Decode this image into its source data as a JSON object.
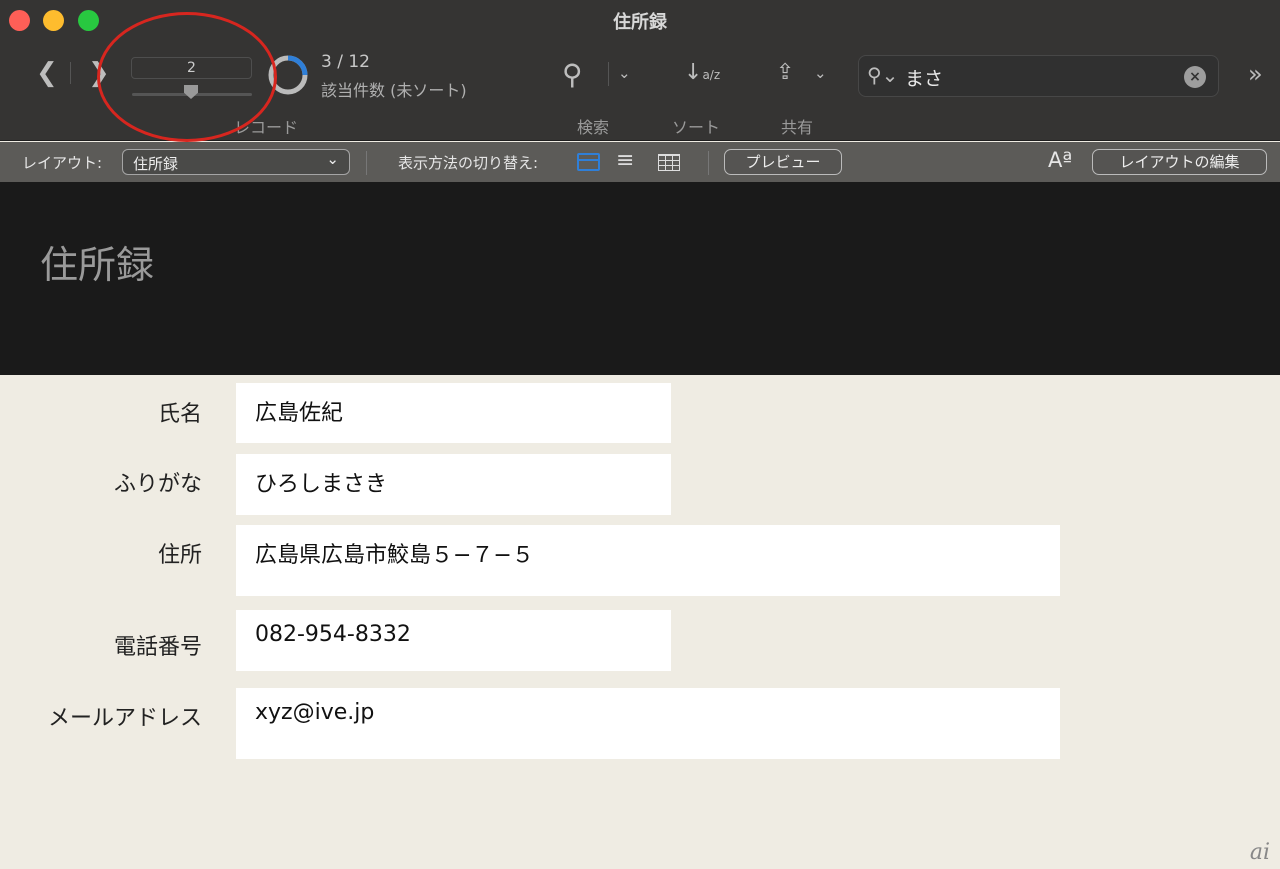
{
  "window": {
    "title": "住所録"
  },
  "toolbar": {
    "record_value": "2",
    "found_count": "3 / 12",
    "found_status": "該当件数 (未ソート)",
    "record_label": "レコード",
    "search_label": "検索",
    "sort_label": "ソート",
    "share_label": "共有",
    "search_query": "まさ",
    "found_fraction": 0.25
  },
  "layoutbar": {
    "layout_label": "レイアウト:",
    "layout_value": "住所録",
    "view_switch_label": "表示方法の切り替え:",
    "preview_label": "プレビュー",
    "edit_layout_label": "レイアウトの編集",
    "font_icon_text": "Aª"
  },
  "header": {
    "title": "住所録"
  },
  "fields": [
    {
      "label": "氏名",
      "value": "広島佐紀"
    },
    {
      "label": "ふりがな",
      "value": "ひろしまさき"
    },
    {
      "label": "住所",
      "value": "広島県広島市鮫島５−７−５"
    },
    {
      "label": "電話番号",
      "value": "082-954-8332"
    },
    {
      "label": "メールアドレス",
      "value": "xyz@ive.jp"
    }
  ],
  "watermark": "ai",
  "colors": {
    "accent": "#2f7fd8",
    "annotation": "#d7261f"
  }
}
